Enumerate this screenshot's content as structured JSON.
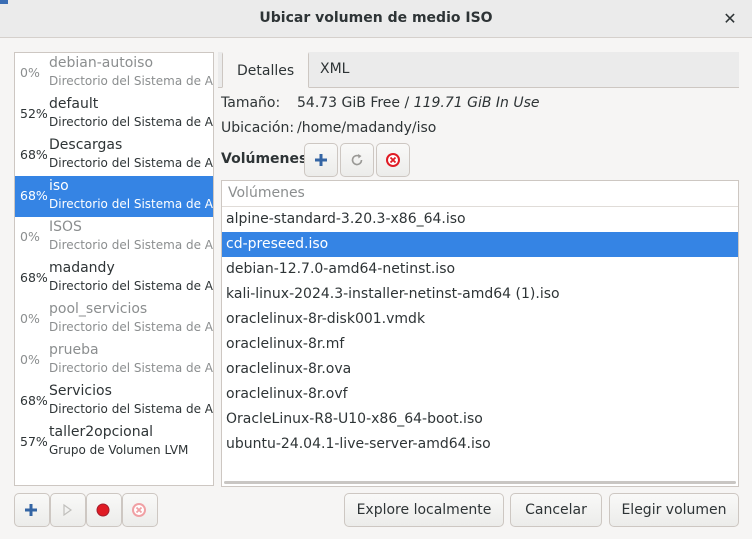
{
  "window": {
    "title": "Ubicar volumen de medio ISO"
  },
  "pools": [
    {
      "pct": "0%",
      "name": "debian-autoiso",
      "desc": "Directorio del Sistema de Archivos",
      "active": false
    },
    {
      "pct": "52%",
      "name": "default",
      "desc": "Directorio del Sistema de Archivos",
      "active": true
    },
    {
      "pct": "68%",
      "name": "Descargas",
      "desc": "Directorio del Sistema de Archivos",
      "active": true
    },
    {
      "pct": "68%",
      "name": "iso",
      "desc": "Directorio del Sistema de Archivos",
      "active": true,
      "selected": true
    },
    {
      "pct": "0%",
      "name": "ISOS",
      "desc": "Directorio del Sistema de Archivos",
      "active": false
    },
    {
      "pct": "68%",
      "name": "madandy",
      "desc": "Directorio del Sistema de Archivos",
      "active": true
    },
    {
      "pct": "0%",
      "name": "pool_servicios",
      "desc": "Directorio del Sistema de Archivos",
      "active": false
    },
    {
      "pct": "0%",
      "name": "prueba",
      "desc": "Directorio del Sistema de Archivos",
      "active": false
    },
    {
      "pct": "68%",
      "name": "Servicios",
      "desc": "Directorio del Sistema de Archivos",
      "active": true
    },
    {
      "pct": "57%",
      "name": "taller2opcional",
      "desc": "Grupo de Volumen LVM",
      "active": true
    }
  ],
  "tabs": {
    "details": "Detalles",
    "xml": "XML"
  },
  "details": {
    "size_label": "Tamaño:",
    "size_free": "54.73 GiB Free",
    "size_sep": " / ",
    "size_used": "119.71 GiB In Use",
    "location_label": "Ubicación:",
    "location_value": "/home/madandy/iso",
    "volumes_label": "Volúmenes"
  },
  "volumes": {
    "header": "Volúmenes",
    "items": [
      "alpine-standard-3.20.3-x86_64.iso",
      "cd-preseed.iso",
      "debian-12.7.0-amd64-netinst.iso",
      "kali-linux-2024.3-installer-netinst-amd64 (1).iso",
      "oraclelinux-8r-disk001.vmdk",
      "oraclelinux-8r.mf",
      "oraclelinux-8r.ova",
      "oraclelinux-8r.ovf",
      "OracleLinux-R8-U10-x86_64-boot.iso",
      "ubuntu-24.04.1-live-server-amd64.iso"
    ],
    "selected_index": 1
  },
  "buttons": {
    "explore": "Explore localmente",
    "cancel": "Cancelar",
    "choose": "Elegir volumen"
  },
  "icons": {
    "add": "plus-icon",
    "refresh": "refresh-icon",
    "delete": "delete-icon",
    "play": "play-icon",
    "stop": "stop-icon",
    "close": "close-icon"
  },
  "colors": {
    "selection": "#3584e4",
    "add_blue": "#3465a4",
    "stop_red": "#e01b24"
  }
}
